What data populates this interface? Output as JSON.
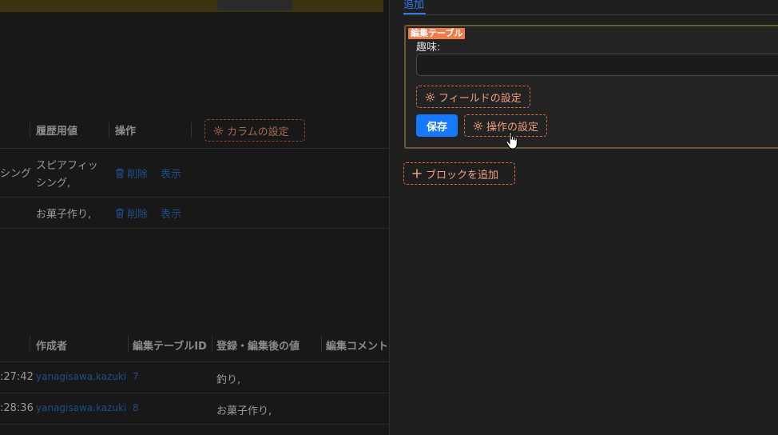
{
  "left_table1": {
    "headers": [
      "履歴用値",
      "操作"
    ],
    "column_settings_label": "カラムの設定",
    "rows": [
      {
        "partial": "シング",
        "value_line1": "スピアフィッ",
        "value_line2": "シング,",
        "delete": "削除",
        "show": "表示"
      },
      {
        "partial": "",
        "value_line1": "お菓子作り,",
        "value_line2": "",
        "delete": "削除",
        "show": "表示"
      }
    ]
  },
  "left_table2": {
    "headers": [
      "作成者",
      "編集テーブルID",
      "登録・編集後の値",
      "編集コメント"
    ],
    "rows": [
      {
        "time": ":27:42",
        "author": "yanagisawa.kazuki",
        "id": "7",
        "value": "釣り,"
      },
      {
        "time": ":28:36",
        "author": "yanagisawa.kazuki",
        "id": "8",
        "value": "お菓子作り,"
      }
    ]
  },
  "drawer": {
    "tab_label": "追加",
    "block_tag": "編集テーブル",
    "field_label": "趣味:",
    "field_value": "",
    "field_settings_label": "フィールドの設定",
    "save_label": "保存",
    "action_settings_label": "操作の設定",
    "add_block_label": "ブロックを追加"
  },
  "colors": {
    "accent": "#1677ff",
    "dashed_orange": "#e06a38",
    "tag_bg": "#f07c4a",
    "link_dim": "#1f4e8a"
  },
  "icons": [
    "gear-icon",
    "trash-icon",
    "plus-icon",
    "hand-cursor-icon"
  ]
}
